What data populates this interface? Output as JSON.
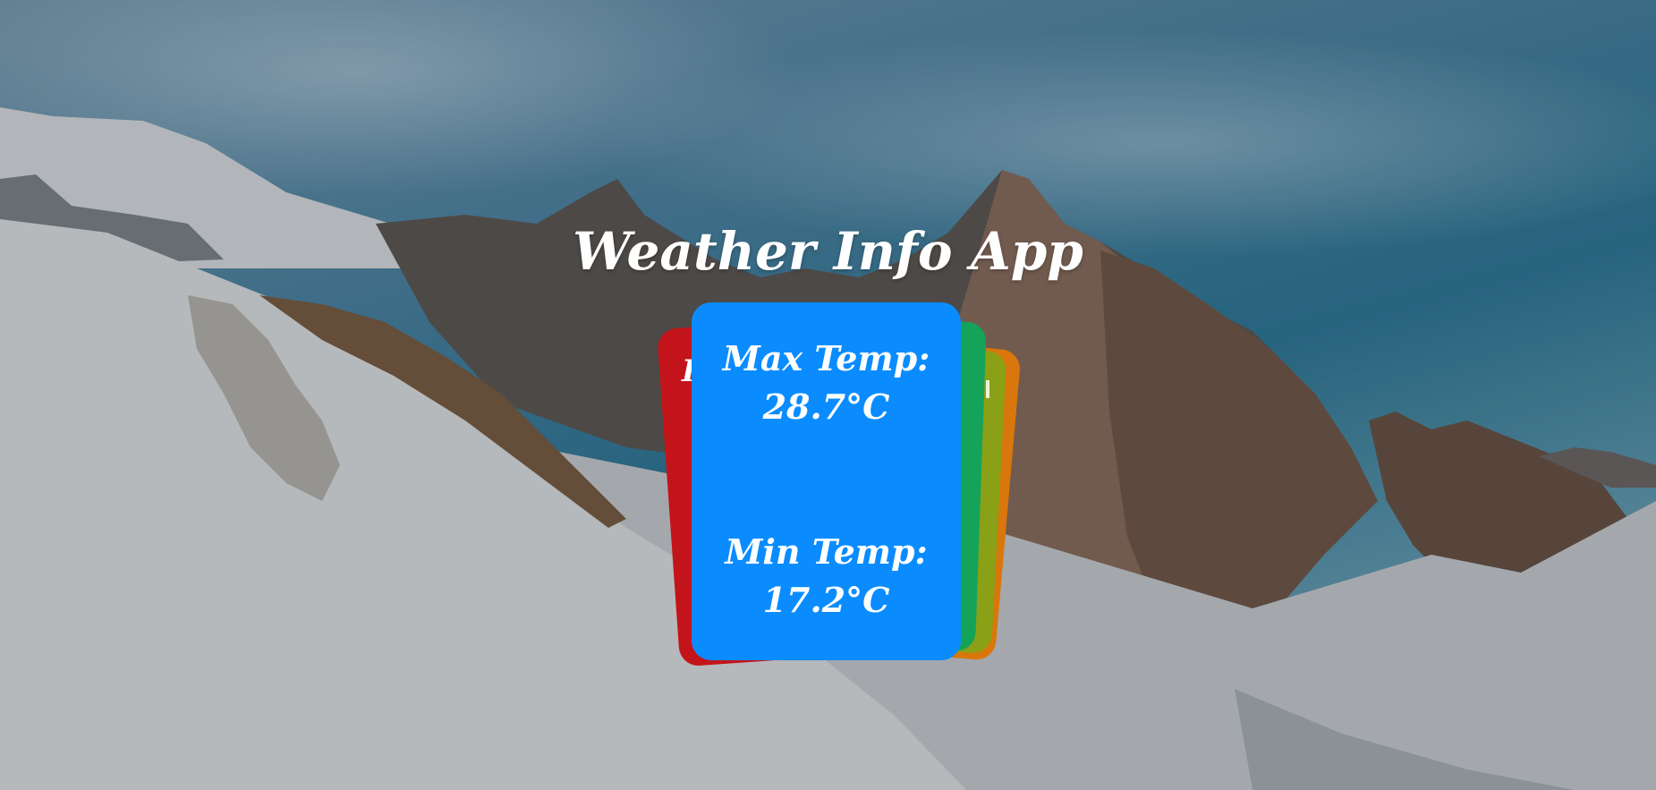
{
  "app": {
    "title": "Weather Info App"
  },
  "card": {
    "max_label": "Max Temp:",
    "max_value": "28.7°C",
    "min_label": "Min Temp:",
    "min_value": "17.2°C",
    "peek_text": "I"
  },
  "colors": {
    "main_card": "#0a8cff",
    "red_card": "#c4141b",
    "green_card": "#15a35a",
    "orange_card": "#d9770c",
    "lime_card": "#8aa016",
    "text": "#ffffff"
  },
  "background": {
    "scene": "snowy mountain range under blue sky"
  }
}
